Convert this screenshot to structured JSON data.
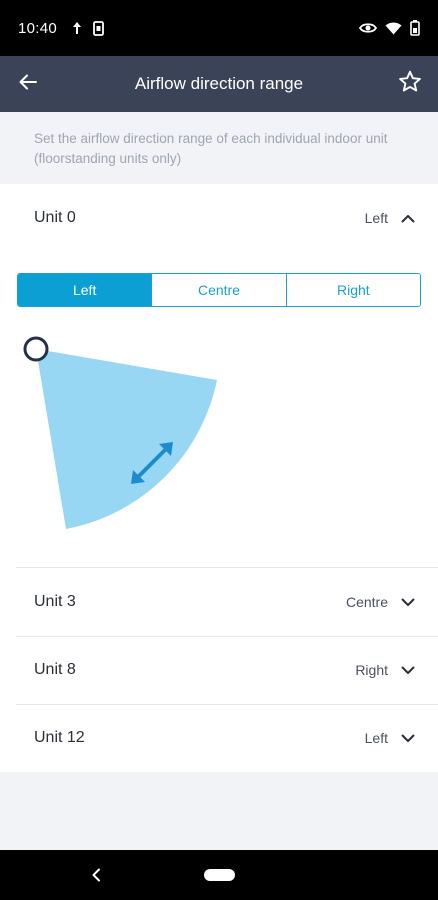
{
  "status_bar": {
    "time": "10:40",
    "left_icons": [
      "data-saver-icon",
      "sim-card-icon"
    ],
    "right_icons": [
      "eye-icon",
      "wifi-icon",
      "battery-icon"
    ]
  },
  "app_bar": {
    "title": "Airflow direction range",
    "back_icon": "arrow-left-icon",
    "favorite_icon": "star-outline-icon"
  },
  "description": "Set the airflow direction range of each individual indoor unit (floorstanding units only)",
  "units": [
    {
      "name": "Unit 0",
      "value": "Left",
      "expanded": true
    },
    {
      "name": "Unit 3",
      "value": "Centre",
      "expanded": false
    },
    {
      "name": "Unit 8",
      "value": "Right",
      "expanded": false
    },
    {
      "name": "Unit 12",
      "value": "Left",
      "expanded": false
    }
  ],
  "segmented": {
    "options": [
      "Left",
      "Centre",
      "Right"
    ],
    "selected": "Left"
  },
  "colors": {
    "app_bar": "#3a4358",
    "accent": "#0c9fd3",
    "airflow_fill": "#97d7f4",
    "arrow": "#1d8ccd"
  }
}
